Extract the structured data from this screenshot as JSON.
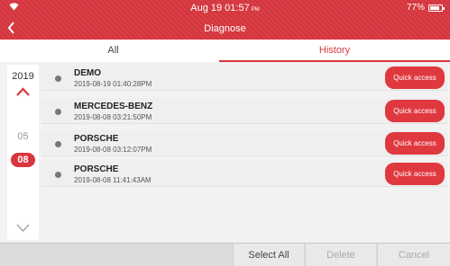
{
  "status_bar": {
    "time": "Aug 19 01:57",
    "ampm": "PM",
    "battery": "77%"
  },
  "header": {
    "title": "Diagnose"
  },
  "tabs": [
    {
      "label": "All"
    },
    {
      "label": "History"
    }
  ],
  "date_panel": {
    "year": "2019",
    "month": "05",
    "day": "08"
  },
  "records": [
    {
      "name": "DEMO",
      "timestamp": "2019-08-19 01:40:28PM",
      "action": "Quick access"
    },
    {
      "name": "MERCEDES-BENZ",
      "timestamp": "2019-08-08 03:21:50PM",
      "action": "Quick access"
    },
    {
      "name": "PORSCHE",
      "timestamp": "2019-08-08 03:12:07PM",
      "action": "Quick access"
    },
    {
      "name": "PORSCHE",
      "timestamp": "2019-08-08 11:41:43AM",
      "action": "Quick access"
    }
  ],
  "footer": {
    "select_all": "Select All",
    "delete": "Delete",
    "cancel": "Cancel"
  },
  "colors": {
    "accent": "#d9373f"
  }
}
